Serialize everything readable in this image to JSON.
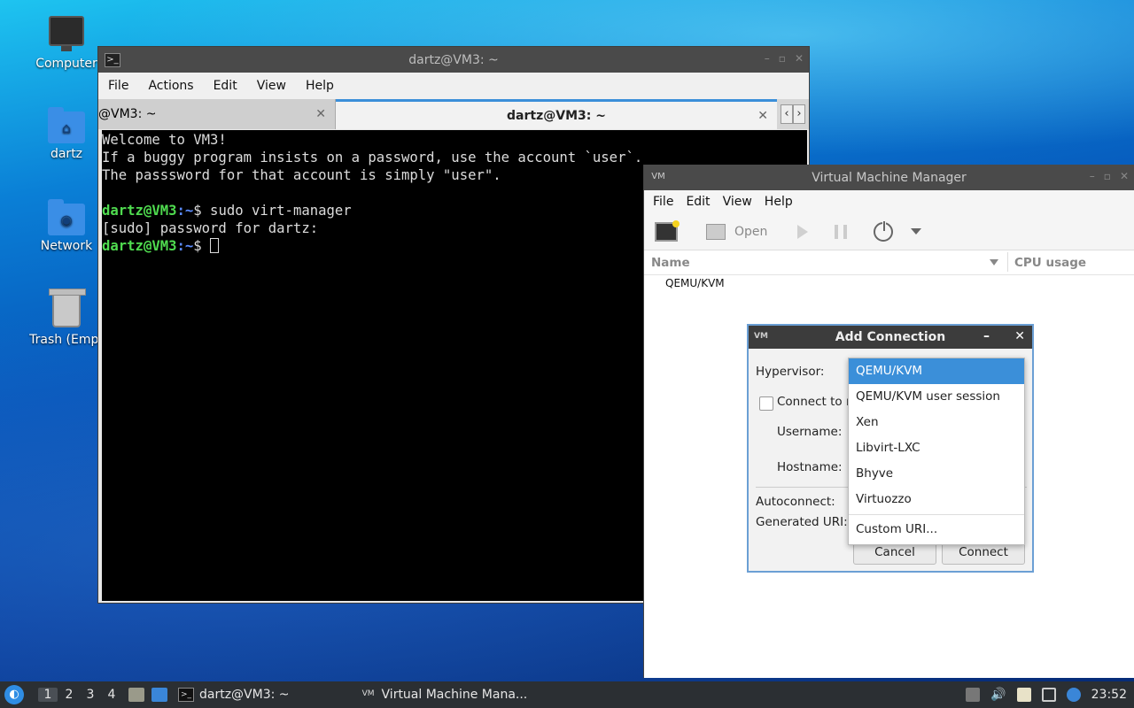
{
  "desktop": {
    "icons": [
      {
        "label": "Computer"
      },
      {
        "label": "dartz"
      },
      {
        "label": "Network"
      },
      {
        "label": "Trash (Empt"
      }
    ]
  },
  "terminal": {
    "title": "dartz@VM3: ~",
    "menu": [
      "File",
      "Actions",
      "Edit",
      "View",
      "Help"
    ],
    "tabs": [
      {
        "label": "@VM3: ~"
      },
      {
        "label": "dartz@VM3: ~"
      }
    ],
    "lines": {
      "l1": "Welcome to VM3!",
      "l2": "If a buggy program insists on a password, use the account `user`.",
      "l3": "The passsword for that account is simply \"user\".",
      "p1_user": "dartz@VM3",
      "p1_path": ":~",
      "p1_cmd": "$ sudo virt-manager",
      "l5": "[sudo] password for dartz:",
      "p2_user": "dartz@VM3",
      "p2_path": ":~",
      "p2_cmd": "$ "
    }
  },
  "vmm": {
    "title": "Virtual Machine Manager",
    "menu": [
      "File",
      "Edit",
      "View",
      "Help"
    ],
    "toolbar": {
      "open_label": "Open"
    },
    "columns": {
      "name": "Name",
      "cpu": "CPU usage"
    },
    "rows": [
      {
        "name": "QEMU/KVM"
      }
    ]
  },
  "add_connection": {
    "title": "Add Connection",
    "hypervisor_label": "Hypervisor:",
    "connect_remote_label": "Connect to re",
    "username_label": "Username:",
    "hostname_label": "Hostname:",
    "autoconnect_label": "Autoconnect:",
    "generated_uri_label": "Generated URI:",
    "cancel_label": "Cancel",
    "connect_label": "Connect",
    "hypervisor_options": [
      "QEMU/KVM",
      "QEMU/KVM user session",
      "Xen",
      "Libvirt-LXC",
      "Bhyve",
      "Virtuozzo",
      "Custom URI..."
    ],
    "selected": "QEMU/KVM"
  },
  "taskbar": {
    "workspaces": [
      "1",
      "2",
      "3",
      "4"
    ],
    "tasks": [
      {
        "label": "dartz@VM3: ~"
      },
      {
        "label": "Virtual Machine Mana..."
      }
    ],
    "clock": "23:52"
  },
  "colors": {
    "accent": "#3b8fd9",
    "prompt_user": "#4fdb4f",
    "prompt_path": "#5b8cff"
  }
}
